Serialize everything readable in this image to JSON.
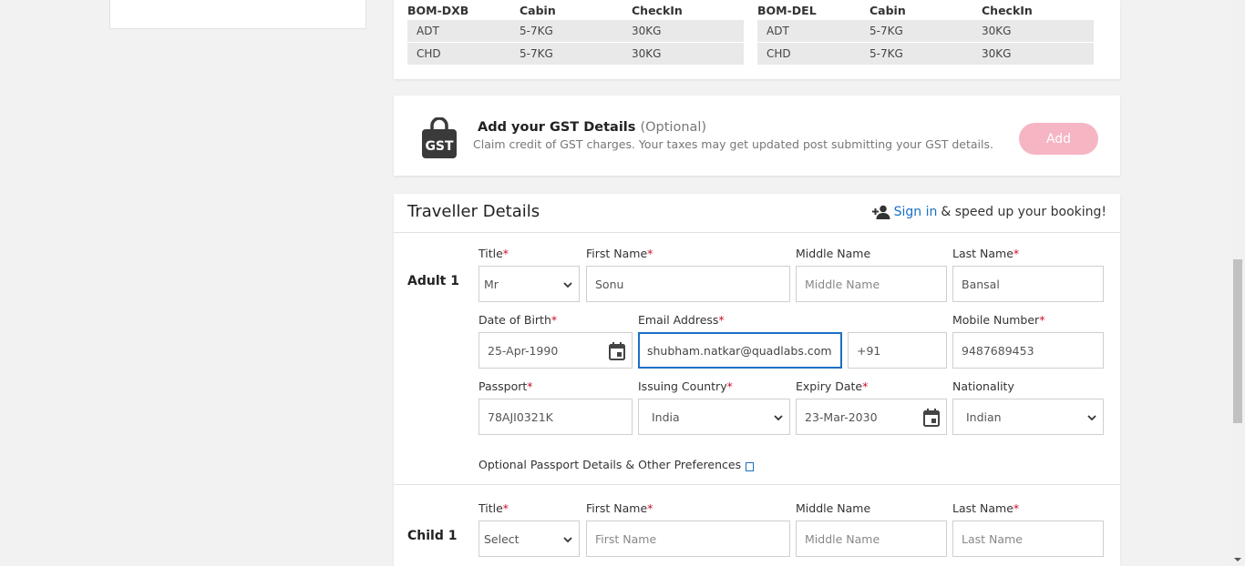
{
  "baggage": [
    {
      "route": "BOM-DXB",
      "cabin_header": "Cabin",
      "checkin_header": "CheckIn",
      "rows": [
        {
          "pax": "ADT",
          "cabin": "5-7KG",
          "checkin": "30KG"
        },
        {
          "pax": "CHD",
          "cabin": "5-7KG",
          "checkin": "30KG"
        }
      ]
    },
    {
      "route": "BOM-DEL",
      "cabin_header": "Cabin",
      "checkin_header": "CheckIn",
      "rows": [
        {
          "pax": "ADT",
          "cabin": "5-7KG",
          "checkin": "30KG"
        },
        {
          "pax": "CHD",
          "cabin": "5-7KG",
          "checkin": "30KG"
        }
      ]
    }
  ],
  "gst": {
    "icon": "gst-bag-icon",
    "icon_text": "GST",
    "title": "Add your GST Details",
    "optional": "(Optional)",
    "subtitle": "Claim credit of GST charges. Your taxes may get updated post submitting your GST details.",
    "add_label": "Add",
    "add_color": "#f6b5c3"
  },
  "traveller": {
    "title": "Traveller Details",
    "signin_link": "Sign in",
    "signin_suffix": "& speed up your booking!",
    "link_color": "#1a6fc6",
    "adult": {
      "label": "Adult 1",
      "title_label": "Title",
      "title_value": "Mr",
      "first_name_label": "First Name",
      "first_name_value": "Sonu",
      "middle_name_label": "Middle Name",
      "middle_name_placeholder": "Middle Name",
      "last_name_label": "Last Name",
      "last_name_value": "Bansal",
      "dob_label": "Date of Birth",
      "dob_value": "25-Apr-1990",
      "email_label": "Email Address",
      "email_value": "shubham.natkar@quadlabs.com",
      "country_code": "+91",
      "mobile_label": "Mobile Number",
      "mobile_value": "9487689453",
      "passport_label": "Passport",
      "passport_value": "78AJI0321K",
      "issuing_label": "Issuing Country",
      "issuing_value": "India",
      "expiry_label": "Expiry Date",
      "expiry_value": "23-Mar-2030",
      "nationality_label": "Nationality",
      "nationality_value": "Indian",
      "optional_prefs": "Optional Passport Details & Other Preferences"
    },
    "child": {
      "label": "Child 1",
      "title_label": "Title",
      "title_value": "Select",
      "first_name_label": "First Name",
      "first_name_placeholder": "First Name",
      "middle_name_label": "Middle Name",
      "middle_name_placeholder": "Middle Name",
      "last_name_label": "Last Name",
      "last_name_placeholder": "Last Name"
    },
    "required_marker": "*"
  }
}
